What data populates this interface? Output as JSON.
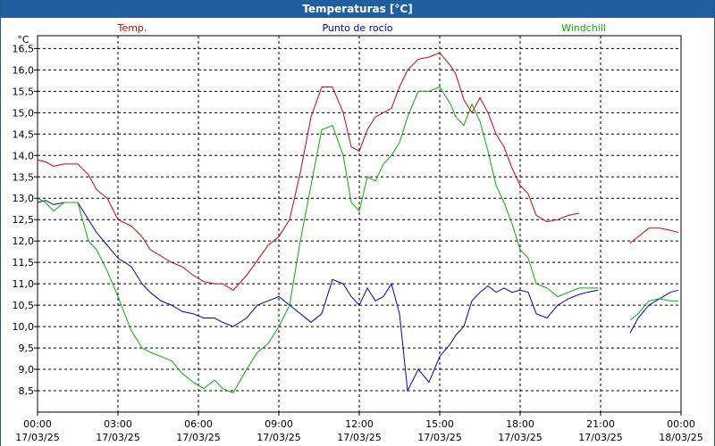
{
  "title": "Temperaturas [°C]",
  "chart_data": {
    "type": "line",
    "title": "Temperaturas [°C]",
    "ylabel": "°C",
    "ylim": [
      8.0,
      16.8
    ],
    "yticks": [
      "16,5",
      "16,0",
      "15,5",
      "15,0",
      "14,5",
      "14,0",
      "13,5",
      "13,0",
      "12,5",
      "12,0",
      "11,5",
      "11,0",
      "10,5",
      "10,0",
      "9,5",
      "9,0",
      "8,5"
    ],
    "ytick_values": [
      16.5,
      16.0,
      15.5,
      15.0,
      14.5,
      14.0,
      13.5,
      13.0,
      12.5,
      12.0,
      11.5,
      11.0,
      10.5,
      10.0,
      9.5,
      9.0,
      8.5
    ],
    "xlim": [
      0,
      24
    ],
    "xticks": [
      {
        "h": 0,
        "time": "00:00",
        "date": "17/03/25"
      },
      {
        "h": 3,
        "time": "03:00",
        "date": "17/03/25"
      },
      {
        "h": 6,
        "time": "06:00",
        "date": "17/03/25"
      },
      {
        "h": 9,
        "time": "09:00",
        "date": "17/03/25"
      },
      {
        "h": 12,
        "time": "12:00",
        "date": "17/03/25"
      },
      {
        "h": 15,
        "time": "15:00",
        "date": "17/03/25"
      },
      {
        "h": 18,
        "time": "18:00",
        "date": "17/03/25"
      },
      {
        "h": 21,
        "time": "21:00",
        "date": "17/03/25"
      },
      {
        "h": 24,
        "time": "00:00",
        "date": "18/03/25"
      }
    ],
    "grid": true,
    "legend_placement": "top",
    "series": [
      {
        "name": "Temp.",
        "color": "#d00000",
        "x": [
          0,
          0.3,
          0.6,
          1,
          1.5,
          1.9,
          2.2,
          2.6,
          3,
          3.5,
          3.9,
          4.2,
          4.6,
          5,
          5.4,
          5.8,
          6.2,
          6.6,
          6.9,
          7.3,
          7.8,
          8.2,
          8.6,
          9,
          9.4,
          9.8,
          10.2,
          10.6,
          11,
          11.4,
          11.7,
          12,
          12.3,
          12.6,
          12.9,
          13.2,
          13.5,
          13.8,
          14.2,
          14.6,
          15,
          15.4,
          15.6,
          15.9,
          16.2,
          16.5,
          16.8,
          17.1,
          17.4,
          17.7,
          18,
          18.3,
          18.6,
          19,
          19.4,
          19.8,
          20.2,
          20.5,
          20.9,
          null,
          22.1,
          22.4,
          22.8,
          23.2,
          23.6,
          23.9
        ],
        "y": [
          13.9,
          13.85,
          13.75,
          13.8,
          13.8,
          13.55,
          13.2,
          13.0,
          12.5,
          12.35,
          12.1,
          11.8,
          11.65,
          11.5,
          11.4,
          11.2,
          11.05,
          11.0,
          11.0,
          10.85,
          11.2,
          11.55,
          11.9,
          12.1,
          12.5,
          13.6,
          14.9,
          15.6,
          15.6,
          15.0,
          14.2,
          14.1,
          14.6,
          14.9,
          15.0,
          15.1,
          15.6,
          16.0,
          16.25,
          16.3,
          16.4,
          16.1,
          15.9,
          15.3,
          15.0,
          15.35,
          15.0,
          14.5,
          14.2,
          13.7,
          13.3,
          13.1,
          12.6,
          12.45,
          12.5,
          12.6,
          12.65,
          null,
          null,
          null,
          11.95,
          12.1,
          12.3,
          12.3,
          12.25,
          12.2
        ]
      },
      {
        "name": "Punto de rocío",
        "color": "#0000c8",
        "x": [
          0,
          0.3,
          0.6,
          1,
          1.5,
          1.9,
          2.2,
          2.6,
          3,
          3.5,
          3.9,
          4.2,
          4.6,
          5,
          5.4,
          5.8,
          6.2,
          6.6,
          6.9,
          7.3,
          7.8,
          8.2,
          8.6,
          9,
          9.4,
          9.8,
          10.2,
          10.6,
          11,
          11.4,
          11.7,
          12,
          12.3,
          12.6,
          12.9,
          13.2,
          13.5,
          13.8,
          14.2,
          14.6,
          15,
          15.4,
          15.6,
          15.9,
          16.2,
          16.5,
          16.8,
          17.1,
          17.4,
          17.7,
          18,
          18.3,
          18.6,
          19,
          19.4,
          19.8,
          20.2,
          20.5,
          20.9,
          null,
          22.1,
          22.4,
          22.8,
          23.2,
          23.6,
          23.9
        ],
        "y": [
          12.9,
          12.95,
          12.85,
          12.9,
          12.9,
          12.5,
          12.2,
          11.9,
          11.6,
          11.4,
          11.0,
          10.8,
          10.6,
          10.5,
          10.35,
          10.3,
          10.2,
          10.2,
          10.1,
          10.0,
          10.2,
          10.5,
          10.6,
          10.7,
          10.5,
          10.3,
          10.1,
          10.3,
          11.1,
          11.0,
          10.7,
          10.5,
          10.9,
          10.6,
          10.7,
          11.0,
          10.3,
          8.5,
          9.0,
          8.7,
          9.3,
          9.6,
          9.8,
          10.0,
          10.6,
          10.8,
          10.95,
          10.8,
          10.9,
          10.8,
          10.85,
          10.8,
          10.3,
          10.2,
          10.5,
          10.65,
          10.75,
          10.8,
          10.85,
          null,
          9.85,
          10.2,
          10.5,
          10.65,
          10.8,
          10.85
        ]
      },
      {
        "name": "Windchill",
        "color": "#00b000",
        "x": [
          0,
          0.3,
          0.6,
          1,
          1.5,
          1.9,
          2.2,
          2.6,
          3,
          3.5,
          3.9,
          4.2,
          4.6,
          5,
          5.4,
          5.8,
          6.2,
          6.6,
          6.9,
          7.3,
          7.8,
          8.2,
          8.6,
          9,
          9.4,
          9.8,
          10.2,
          10.6,
          11,
          11.4,
          11.7,
          12,
          12.3,
          12.6,
          12.9,
          13.2,
          13.5,
          13.8,
          14.2,
          14.6,
          15,
          15.4,
          15.6,
          15.9,
          16.2,
          16.5,
          16.8,
          17.1,
          17.4,
          17.7,
          18,
          18.3,
          18.6,
          19,
          19.4,
          19.8,
          20.2,
          20.5,
          20.9,
          null,
          22.1,
          22.4,
          22.8,
          23.2,
          23.6,
          23.9
        ],
        "y": [
          13.0,
          12.9,
          12.7,
          12.9,
          12.9,
          12.0,
          11.8,
          11.3,
          10.7,
          9.9,
          9.5,
          9.4,
          9.3,
          9.2,
          8.9,
          8.7,
          8.55,
          8.75,
          8.55,
          8.45,
          9.0,
          9.4,
          9.6,
          10.0,
          10.5,
          12.0,
          13.3,
          14.6,
          14.7,
          14.0,
          12.9,
          12.7,
          13.5,
          13.4,
          13.8,
          14.0,
          14.3,
          14.9,
          15.5,
          15.5,
          15.6,
          15.2,
          14.9,
          14.7,
          15.2,
          14.8,
          14.1,
          13.3,
          12.9,
          12.4,
          11.8,
          11.6,
          11.0,
          10.9,
          10.7,
          10.8,
          10.9,
          10.9,
          10.9,
          null,
          10.15,
          10.3,
          10.6,
          10.65,
          10.6,
          10.6
        ]
      }
    ]
  }
}
